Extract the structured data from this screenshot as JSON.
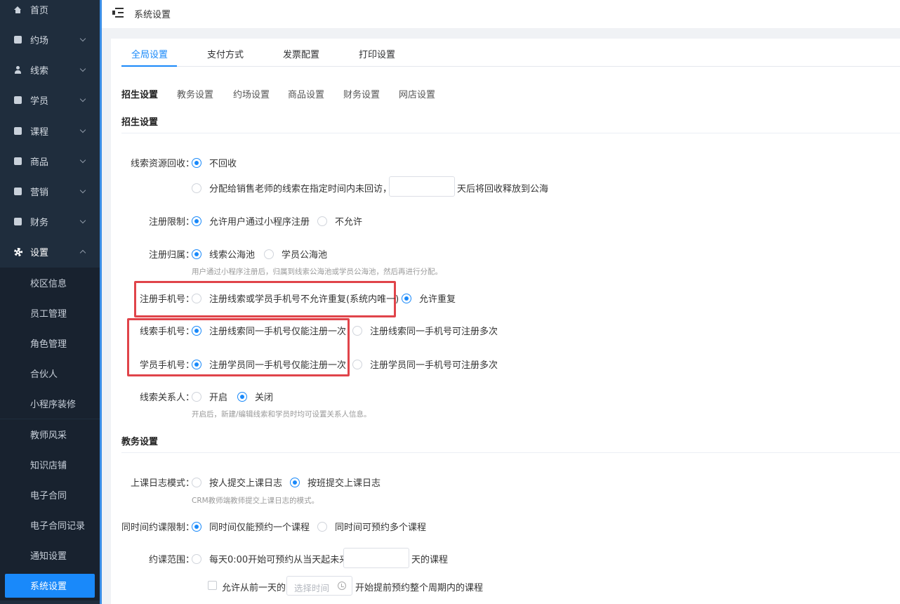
{
  "sidebar": {
    "items": [
      {
        "label": "首页",
        "icon": "home-icon"
      },
      {
        "label": "约场",
        "icon": "calendar-check-icon"
      },
      {
        "label": "线索",
        "icon": "user-plus-icon"
      },
      {
        "label": "学员",
        "icon": "id-card-icon"
      },
      {
        "label": "课程",
        "icon": "book-icon"
      },
      {
        "label": "商品",
        "icon": "bag-icon"
      },
      {
        "label": "营销",
        "icon": "tag-icon"
      },
      {
        "label": "财务",
        "icon": "yen-icon"
      },
      {
        "label": "设置",
        "icon": "gear-icon"
      }
    ],
    "settings_sub": [
      "校区信息",
      "员工管理",
      "角色管理",
      "合伙人",
      "小程序装修",
      "教师风采",
      "知识店铺",
      "电子合同",
      "电子合同记录",
      "通知设置",
      "系统设置"
    ]
  },
  "header": {
    "title": "系统设置"
  },
  "tabs": [
    "全局设置",
    "支付方式",
    "发票配置",
    "打印设置"
  ],
  "subtabs": [
    "招生设置",
    "教务设置",
    "约场设置",
    "商品设置",
    "财务设置",
    "网店设置"
  ],
  "enroll": {
    "title": "招生设置",
    "recycle": {
      "label": "线索资源回收：",
      "opt1": "不回收",
      "opt2": "分配给销售老师的线索在指定时间内未回访，",
      "opt2_suffix": "天后将回收释放到公海"
    },
    "reg_limit": {
      "label": "注册限制：",
      "opt1": "允许用户通过小程序注册",
      "opt2": "不允许"
    },
    "reg_owner": {
      "label": "注册归属：",
      "opt1": "线索公海池",
      "opt2": "学员公海池",
      "hint": "用户通过小程序注册后，归属到线索公海池或学员公海池，然后再进行分配。"
    },
    "reg_phone": {
      "label": "注册手机号：",
      "opt1": "注册线索或学员手机号不允许重复(系统内唯一)",
      "opt2": "允许重复"
    },
    "lead_phone": {
      "label": "线索手机号：",
      "opt1": "注册线索同一手机号仅能注册一次",
      "opt2": "注册线索同一手机号可注册多次"
    },
    "student_phone": {
      "label": "学员手机号：",
      "opt1": "注册学员同一手机号仅能注册一次",
      "opt2": "注册学员同一手机号可注册多次"
    },
    "contact": {
      "label": "线索关系人：",
      "opt1": "开启",
      "opt2": "关闭",
      "hint": "开启后，新建/编辑线索和学员时均可设置关系人信息。"
    }
  },
  "teaching": {
    "title": "教务设置",
    "log_mode": {
      "label": "上课日志模式：",
      "opt1": "按人提交上课日志",
      "opt2": "按班提交上课日志",
      "hint": "CRM教师端教师提交上课日志的模式。"
    },
    "limit": {
      "label": "同时间约课限制：",
      "opt1": "同时间仅能预约一个课程",
      "opt2": "同时间可预约多个课程"
    },
    "range": {
      "label": "约课范围：",
      "opt1": "每天0:00开始可预约从当天起未来",
      "opt1_suffix": "天的课程",
      "check_prefix": "允许从前一天的",
      "time_placeholder": "选择时间",
      "check_suffix": "开始提前预约整个周期内的课程"
    }
  },
  "colors": {
    "accent": "#1989fa",
    "sidebar_bg": "#1f2d3d",
    "highlight": "#e0444a"
  }
}
